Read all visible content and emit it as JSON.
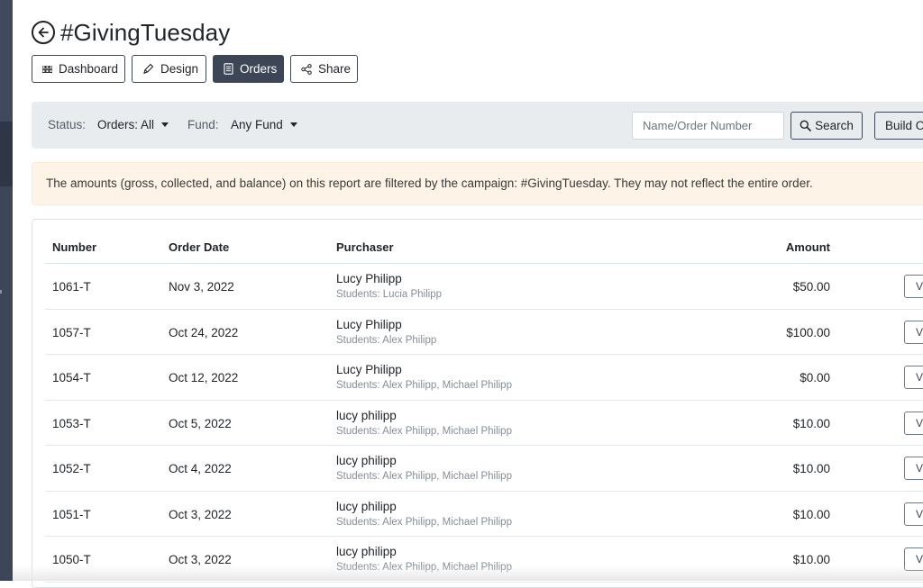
{
  "page": {
    "title": "#GivingTuesday"
  },
  "tabs": [
    {
      "label": "Dashboard",
      "icon": "grid-icon",
      "active": false
    },
    {
      "label": "Design",
      "icon": "pen-icon",
      "active": false
    },
    {
      "label": "Orders",
      "icon": "document-icon",
      "active": true
    },
    {
      "label": "Share",
      "icon": "share-icon",
      "active": false
    }
  ],
  "filters": {
    "status_label": "Status:",
    "status_value": "Orders: All",
    "fund_label": "Fund:",
    "fund_value": "Any Fund",
    "search_placeholder": "Name/Order Number",
    "search_button": "Search",
    "build_button": "Build O"
  },
  "alert": {
    "text": "The amounts (gross, collected, and balance) on this report are filtered by the campaign: #GivingTuesday. They may not reflect the entire order."
  },
  "table": {
    "headers": {
      "number": "Number",
      "date": "Order Date",
      "purchaser": "Purchaser",
      "amount": "Amount"
    },
    "view_label": "V",
    "rows": [
      {
        "number": "1061-T",
        "date": "Nov 3, 2022",
        "purchaser": "Lucy Philipp",
        "students": "Students: Lucia Philipp",
        "amount": "$50.00"
      },
      {
        "number": "1057-T",
        "date": "Oct 24, 2022",
        "purchaser": "Lucy Philipp",
        "students": "Students: Alex Philipp",
        "amount": "$100.00"
      },
      {
        "number": "1054-T",
        "date": "Oct 12, 2022",
        "purchaser": "Lucy Philipp",
        "students": "Students: Alex Philipp, Michael Philipp",
        "amount": "$0.00"
      },
      {
        "number": "1053-T",
        "date": "Oct 5, 2022",
        "purchaser": "lucy philipp",
        "students": "Students: Alex Philipp, Michael Philipp",
        "amount": "$10.00"
      },
      {
        "number": "1052-T",
        "date": "Oct 4, 2022",
        "purchaser": "lucy philipp",
        "students": "Students: Alex Philipp, Michael Philipp",
        "amount": "$10.00"
      },
      {
        "number": "1051-T",
        "date": "Oct 3, 2022",
        "purchaser": "lucy philipp",
        "students": "Students: Alex Philipp, Michael Philipp",
        "amount": "$10.00"
      },
      {
        "number": "1050-T",
        "date": "Oct 3, 2022",
        "purchaser": "lucy philipp",
        "students": "Students: Alex Philipp, Michael Philipp",
        "amount": "$10.00"
      }
    ]
  },
  "colors": {
    "primary": "#3d4656",
    "filter_bg": "#e9ecef",
    "alert_bg": "#fdf3e6"
  }
}
